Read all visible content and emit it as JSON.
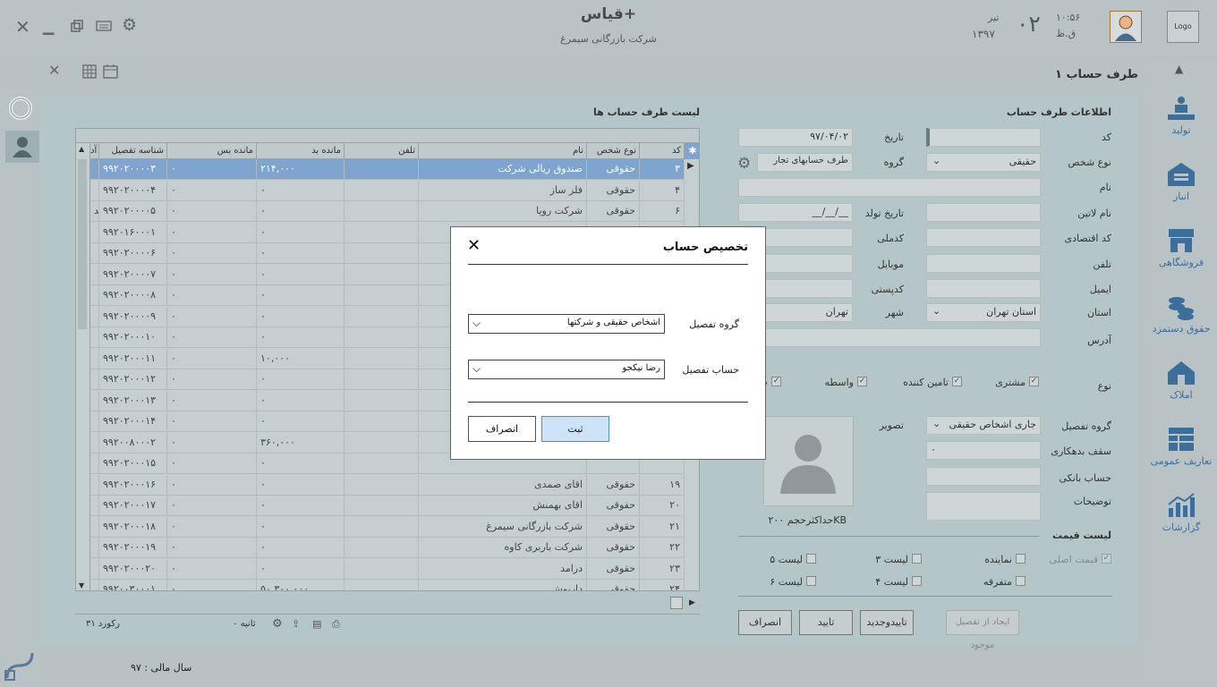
{
  "app": {
    "title": "قیاس+",
    "company": "شرکت بازرگانی سیمرغ",
    "logo": "Logo"
  },
  "clock": {
    "time": "۱۰:۵۶",
    "ampm": "ق.ظ",
    "day": "۰۲",
    "month": "تیر",
    "year": "۱۳۹۷"
  },
  "page_title": "طرف حساب ۱",
  "sidebar": {
    "items": [
      {
        "label": "تولید",
        "icon": "production-icon"
      },
      {
        "label": "انبار",
        "icon": "warehouse-icon"
      },
      {
        "label": "فروشگاهی",
        "icon": "store-icon"
      },
      {
        "label": "حقوق دستمزد",
        "icon": "payroll-coins-icon"
      },
      {
        "label": "املاک",
        "icon": "property-house-icon"
      },
      {
        "label": "تعاریف عمومی",
        "icon": "definitions-table-icon"
      },
      {
        "label": "گزارشات",
        "icon": "reports-chart-icon"
      }
    ]
  },
  "form": {
    "section_title": "اطلاعات طرف حساب",
    "labels": {
      "code": "کد",
      "person_type": "نوع شخص",
      "name": "نام",
      "latin_name": "نام لاتین",
      "economic_code": "کد اقتصادی",
      "phone": "تلفن",
      "email": "ایمیل",
      "province": "استان",
      "address": "آدرس",
      "date": "تاریخ",
      "group": "گروه",
      "birth_date": "تاریخ تولد",
      "national_code": "کدملی",
      "mobile": "موبایل",
      "postal_code": "کدپستی",
      "city": "شهر",
      "type": "نوع",
      "detail_group": "گروه تفصیل",
      "image": "تصویر",
      "debt_ceiling": "سقف بدهکاری",
      "bank_account": "حساب بانکی",
      "notes": "توضیحات",
      "price_list": "لیست قیمت"
    },
    "values": {
      "date": "۹۷/۰۴/۰۲",
      "person_type": "حقیقی",
      "group": "طرف حسابهای تجار",
      "birth_date": "__/__/__",
      "province": "استان تهران",
      "city": "تهران",
      "detail_group": "جاری اشخاص حقیقی",
      "debt_ceiling": "۰"
    },
    "type_checks": [
      {
        "label": "مشتری",
        "checked": true
      },
      {
        "label": "تامین کننده",
        "checked": true
      },
      {
        "label": "واسطه",
        "checked": true
      },
      {
        "label": "پ",
        "checked": true
      }
    ],
    "max_size": "حداکثرحجم ۲۰۰KB",
    "price_checks": [
      {
        "label": "قیمت اصلی",
        "checked": true,
        "disabled": true
      },
      {
        "label": "نماینده",
        "checked": false
      },
      {
        "label": "متفرقه",
        "checked": false
      },
      {
        "label": "لیست ۳",
        "checked": false
      },
      {
        "label": "لیست ۴",
        "checked": false
      },
      {
        "label": "لیست ۵",
        "checked": false
      },
      {
        "label": "لیست ۶",
        "checked": false
      }
    ],
    "buttons": {
      "create_from": "ایجاد از تفصیل موجود",
      "confirm_new": "تاییدوجدید",
      "confirm": "تایید",
      "cancel": "انصراف"
    }
  },
  "grid": {
    "title": "لیست طرف حساب ها",
    "columns": [
      "کد",
      "نوع شخص",
      "نام",
      "تلفن",
      "مانده بد",
      "مانده بس",
      "شناسه تفصیل",
      "آد"
    ],
    "rows": [
      {
        "code": "۳",
        "type": "حقوقی",
        "name": "صندوق ریالی شرکت",
        "debit": "۲۱۴,۰۰۰",
        "credit": "۰",
        "detail": "۹۹۲۰۲۰۰۰۰۳",
        "selected": true
      },
      {
        "code": "۴",
        "type": "حقوقی",
        "name": "فلز ساز",
        "debit": "۰",
        "credit": "۰",
        "detail": "۹۹۲۰۲۰۰۰۰۴"
      },
      {
        "code": "۶",
        "type": "حقوقی",
        "name": "شرکت رویا",
        "debit": "۰",
        "credit": "۰",
        "detail": "۹۹۲۰۲۰۰۰۰۵",
        "extra": "تد"
      },
      {
        "code": "",
        "type": "",
        "name": "",
        "debit": "۰",
        "credit": "۰",
        "detail": "۹۹۲۰۱۶۰۰۰۱"
      },
      {
        "code": "",
        "type": "",
        "name": "",
        "debit": "۰",
        "credit": "۰",
        "detail": "۹۹۲۰۲۰۰۰۰۶"
      },
      {
        "code": "",
        "type": "",
        "name": "",
        "debit": "۰",
        "credit": "۰",
        "detail": "۹۹۲۰۲۰۰۰۰۷"
      },
      {
        "code": "",
        "type": "",
        "name": "",
        "debit": "۰",
        "credit": "۰",
        "detail": "۹۹۲۰۲۰۰۰۰۸"
      },
      {
        "code": "",
        "type": "",
        "name": "",
        "debit": "۰",
        "credit": "۰",
        "detail": "۹۹۲۰۲۰۰۰۰۹"
      },
      {
        "code": "",
        "type": "",
        "name": "",
        "debit": "۰",
        "credit": "۰",
        "detail": "۹۹۲۰۲۰۰۰۱۰"
      },
      {
        "code": "",
        "type": "",
        "name": "",
        "debit": "۱۰,۰۰۰",
        "credit": "۰",
        "detail": "۹۹۲۰۲۰۰۰۱۱"
      },
      {
        "code": "",
        "type": "",
        "name": "",
        "debit": "۰",
        "credit": "۰",
        "detail": "۹۹۲۰۲۰۰۰۱۲"
      },
      {
        "code": "",
        "type": "",
        "name": "",
        "debit": "۰",
        "credit": "۰",
        "detail": "۹۹۲۰۲۰۰۰۱۳"
      },
      {
        "code": "",
        "type": "",
        "name": "",
        "debit": "۰",
        "credit": "۰",
        "detail": "۹۹۲۰۲۰۰۰۱۴"
      },
      {
        "code": "",
        "type": "",
        "name": "",
        "debit": "۳۶۰,۰۰۰",
        "credit": "۰",
        "detail": "۹۹۲۰۰۸۰۰۰۲"
      },
      {
        "code": "",
        "type": "",
        "name": "",
        "debit": "۰",
        "credit": "۰",
        "detail": "۹۹۲۰۲۰۰۰۱۵"
      },
      {
        "code": "۱۹",
        "type": "حقوقی",
        "name": "اقای صمدی",
        "debit": "۰",
        "credit": "۰",
        "detail": "۹۹۲۰۲۰۰۰۱۶"
      },
      {
        "code": "۲۰",
        "type": "حقوقی",
        "name": "اقای بهمنش",
        "debit": "۰",
        "credit": "۰",
        "detail": "۹۹۲۰۲۰۰۰۱۷"
      },
      {
        "code": "۲۱",
        "type": "حقوقی",
        "name": "شرکت بازرگانی سیمرغ",
        "debit": "۰",
        "credit": "۰",
        "detail": "۹۹۲۰۲۰۰۰۱۸"
      },
      {
        "code": "۲۲",
        "type": "حقوقی",
        "name": "شرکت  باربری کاوه",
        "debit": "۰",
        "credit": "۰",
        "detail": "۹۹۲۰۲۰۰۰۱۹"
      },
      {
        "code": "۲۳",
        "type": "حقوقی",
        "name": "درامد",
        "debit": "۰",
        "credit": "۰",
        "detail": "۹۹۲۰۲۰۰۰۲۰"
      },
      {
        "code": "۲۴",
        "type": "حقوقی",
        "name": "داربوش",
        "debit": "۵۰,۳۰۰,۰۰۰",
        "credit": "۰",
        "detail": "۹۹۲۰۰۳۰۰۰۱"
      }
    ],
    "record_count": "۳۱ رکورد",
    "timer": "۰ ثانیه"
  },
  "modal": {
    "title": "تخصیص حساب",
    "group_label": "گروه تفصیل",
    "group_value": "اشخاص حقیقی و شرکتها",
    "account_label": "حساب تفصیل",
    "account_value": "رضا نیکجو",
    "submit": "ثبت",
    "cancel": "انصراف"
  },
  "status": {
    "fiscal_year": "سال مالی : ۹۷"
  },
  "colors": {
    "accent": "#3b6e9a",
    "selected_row": "#7fa5cf",
    "submit_btn": "#cde4f7"
  }
}
